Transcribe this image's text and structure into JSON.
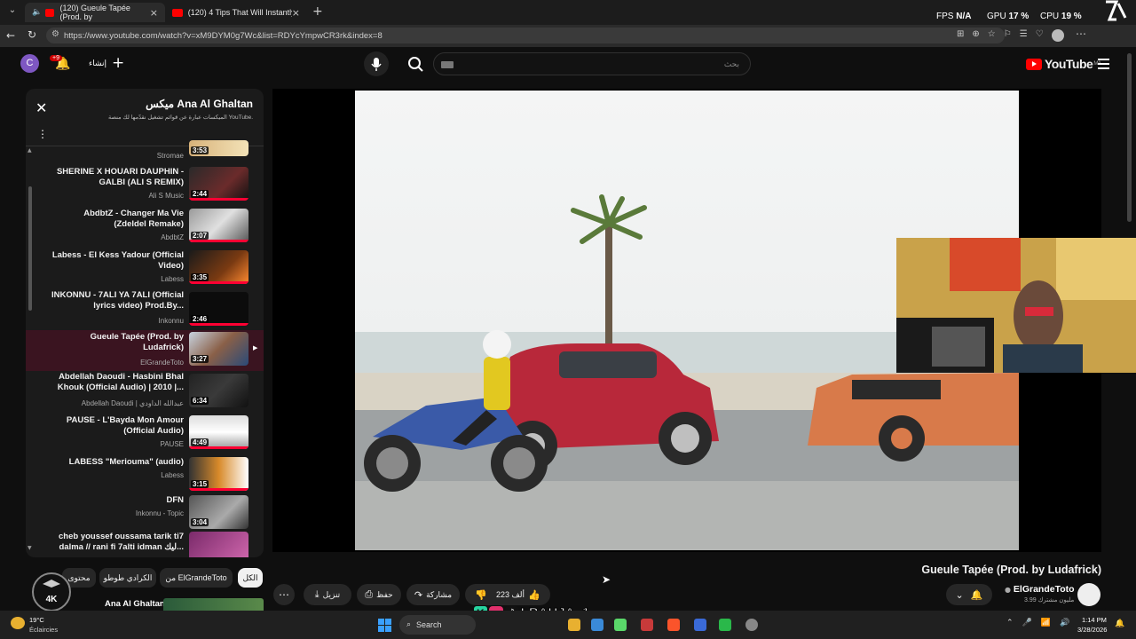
{
  "browser": {
    "tabs": [
      {
        "title": "(120) Gueule Tapée (Prod. by",
        "active": true
      },
      {
        "title": "(120) 4 Tips That Will Instantly Fix",
        "active": false
      }
    ],
    "url": "https://www.youtube.com/watch?v=xM9DYM0g7Wc&list=RDYcYmpwCR3rk&index=8",
    "url_domain": "www.youtube.com"
  },
  "overlay_stats": {
    "fps_label": "FPS",
    "fps_value": "N/A",
    "gpu_label": "GPU",
    "gpu_value": "17 %",
    "cpu_label": "CPU",
    "cpu_value": "19 %",
    "brand": "twareg"
  },
  "youtube_header": {
    "avatar_letter": "C",
    "notif_count": "+9",
    "create_label": "إنشاء",
    "search_placeholder": "بحث",
    "logo_text": "YouTube",
    "logo_region": "MA"
  },
  "playlist": {
    "title": "ميكس Ana Al Ghaltan",
    "subtitle": "الميكسات عبارة عن قوائم تشغيل نقدّمها لك منصة YouTube.",
    "items": [
      {
        "title": "",
        "channel": "Stromae",
        "duration": "3:53"
      },
      {
        "title": "SHERINE X HOUARI DAUPHIN - GALBI (ALI S REMIX)",
        "channel": "Ali S Music",
        "duration": "2:44"
      },
      {
        "title": "AbdbtZ - Changer Ma Vie (Zdeldel Remake)",
        "channel": "AbdbtZ",
        "duration": "2:07"
      },
      {
        "title": "Labess - El Kess Yadour (Official Video)",
        "channel": "Labess",
        "duration": "3:35"
      },
      {
        "title": "INKONNU - 7ALI YA 7ALI (Official lyrics video) Prod.By...",
        "channel": "Inkonnu",
        "duration": "2:46"
      },
      {
        "title": "Gueule Tapée (Prod. by Ludafrick)",
        "channel": "ElGrandeToto",
        "duration": "3:27",
        "current": true
      },
      {
        "title": "Abdellah Daoudi - Hasbini Bhal Khouk (Official Audio) | 2010 |...",
        "channel": "Abdellah Daoudi | عبدالله الداودي",
        "duration": "6:34"
      },
      {
        "title": "PAUSE - L'Bayda Mon Amour (Official Audio)",
        "channel": "PAUSE",
        "duration": "4:49"
      },
      {
        "title": "LABESS \"Meriouma\" (audio)",
        "channel": "Labess",
        "duration": "3:15"
      },
      {
        "title": "DFN",
        "channel": "Inkonnu - Topic",
        "duration": "3:04"
      },
      {
        "title": "cheb youssef oussama tarik ti7 dalma // rani fi 7alti idman ليك...",
        "channel": "",
        "duration": ""
      }
    ]
  },
  "chips": [
    {
      "label": "الكل"
    },
    {
      "label": "من ElGrandeToto"
    },
    {
      "label": "الكرادي طوطو"
    },
    {
      "label": "محتوى"
    }
  ],
  "next_item": {
    "title": "Ana Al Ghaltan"
  },
  "video": {
    "title": "Gueule Tapée (Prod. by Ludafrick)",
    "channel": "ElGrandeToto",
    "subscribers": "3.99 مليون مشترك",
    "likes": "223 ألف",
    "share_label": "مشاركة",
    "save_label": "حفظ",
    "download_label": "تنزيل"
  },
  "stream_overlay": {
    "tiktok_handle": "LBAHJA_1",
    "badge_text": "4K"
  },
  "taskbar": {
    "weather_temp": "19°C",
    "weather_desc": "Éclaircies",
    "search_label": "Search",
    "time": "1:14 PM",
    "date": "3/28/2026"
  },
  "colors": {
    "accent": "#ff0033",
    "bg": "#0f0f0f",
    "panel": "#1b1b1b",
    "chip": "#272727"
  }
}
